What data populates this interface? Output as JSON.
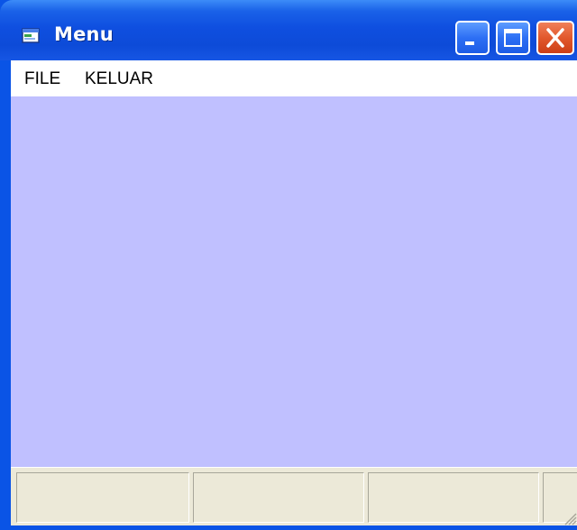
{
  "window": {
    "title": "Menu",
    "icon": "form-window-icon",
    "controls": [
      "minimize-icon",
      "maximize-icon",
      "close-icon"
    ]
  },
  "menubar": {
    "items": [
      {
        "label": "FILE"
      },
      {
        "label": "KELUAR"
      }
    ]
  },
  "client": {
    "background": "#c0c0ff"
  },
  "statusbar": {
    "panels": [
      "",
      "",
      "",
      ""
    ]
  },
  "colors": {
    "titlebar": "#0d4bd8",
    "close_button": "#e2582c",
    "client_background": "#c0c0ff",
    "statusbar": "#ece9d8"
  }
}
